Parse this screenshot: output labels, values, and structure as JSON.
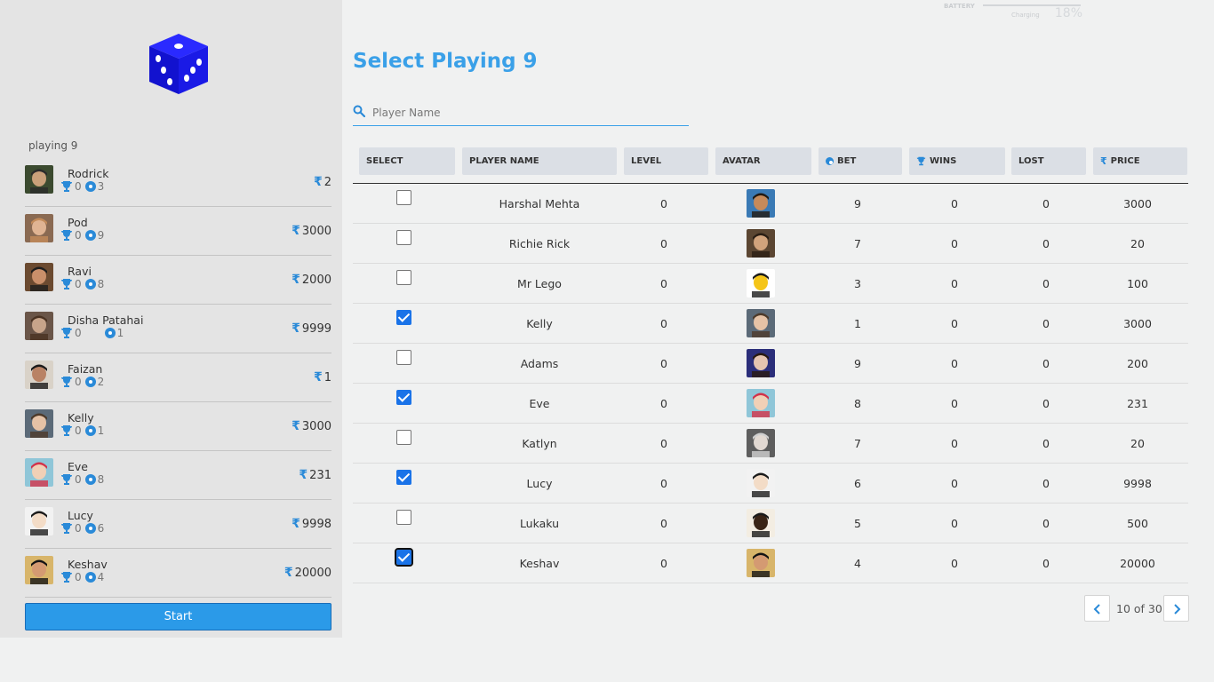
{
  "sidebar": {
    "caption": "playing 9",
    "start_label": "Start",
    "roster": [
      {
        "name": "Rodrick",
        "wins": "0",
        "bets": "3",
        "price": "2",
        "avatar": "av-rodrick"
      },
      {
        "name": "Pod",
        "wins": "0",
        "bets": "9",
        "price": "3000",
        "avatar": "av-pod"
      },
      {
        "name": "Ravi",
        "wins": "0",
        "bets": "8",
        "price": "2000",
        "avatar": "av-ravi"
      },
      {
        "name": "Disha Patahai",
        "wins": "0",
        "bets": "1",
        "price": "9999",
        "avatar": "av-disha"
      },
      {
        "name": "Faizan",
        "wins": "0",
        "bets": "2",
        "price": "1",
        "avatar": "av-faizan"
      },
      {
        "name": "Kelly",
        "wins": "0",
        "bets": "1",
        "price": "3000",
        "avatar": "av-kelly"
      },
      {
        "name": "Eve",
        "wins": "0",
        "bets": "8",
        "price": "231",
        "avatar": "av-eve"
      },
      {
        "name": "Lucy",
        "wins": "0",
        "bets": "6",
        "price": "9998",
        "avatar": "av-lucy"
      },
      {
        "name": "Keshav",
        "wins": "0",
        "bets": "4",
        "price": "20000",
        "avatar": "av-keshav"
      }
    ]
  },
  "battery": {
    "label": "BATTERY",
    "percent": "18%",
    "status": "Charging",
    "level": 0.18
  },
  "main": {
    "title": "Select Playing 9",
    "search": {
      "placeholder": "Player Name",
      "value": ""
    },
    "columns": [
      "SELECT",
      "PLAYER NAME",
      "LEVEL",
      "AVATAR",
      "BET",
      "WINS",
      "LOST",
      "PRICE"
    ],
    "rows": [
      {
        "checked": false,
        "name": "Harshal Mehta",
        "level": "0",
        "bet": "9",
        "wins": "0",
        "lost": "0",
        "price": "3000",
        "avatar": "av-harshal"
      },
      {
        "checked": false,
        "name": "Richie Rick",
        "level": "0",
        "bet": "7",
        "wins": "0",
        "lost": "0",
        "price": "20",
        "avatar": "av-richie"
      },
      {
        "checked": false,
        "name": "Mr Lego",
        "level": "0",
        "bet": "3",
        "wins": "0",
        "lost": "0",
        "price": "100",
        "avatar": "av-lego"
      },
      {
        "checked": true,
        "name": "Kelly",
        "level": "0",
        "bet": "1",
        "wins": "0",
        "lost": "0",
        "price": "3000",
        "avatar": "av-kelly"
      },
      {
        "checked": false,
        "name": "Adams",
        "level": "0",
        "bet": "9",
        "wins": "0",
        "lost": "0",
        "price": "200",
        "avatar": "av-adams"
      },
      {
        "checked": true,
        "name": "Eve",
        "level": "0",
        "bet": "8",
        "wins": "0",
        "lost": "0",
        "price": "231",
        "avatar": "av-eve"
      },
      {
        "checked": false,
        "name": "Katlyn",
        "level": "0",
        "bet": "7",
        "wins": "0",
        "lost": "0",
        "price": "20",
        "avatar": "av-katlyn"
      },
      {
        "checked": true,
        "name": "Lucy",
        "level": "0",
        "bet": "6",
        "wins": "0",
        "lost": "0",
        "price": "9998",
        "avatar": "av-lucy"
      },
      {
        "checked": false,
        "name": "Lukaku",
        "level": "0",
        "bet": "5",
        "wins": "0",
        "lost": "0",
        "price": "500",
        "avatar": "av-lukaku"
      },
      {
        "checked": true,
        "name": "Keshav",
        "level": "0",
        "bet": "4",
        "wins": "0",
        "lost": "0",
        "price": "20000",
        "avatar": "av-keshav",
        "focused": true
      }
    ],
    "pagination": {
      "text": "10 of 30"
    }
  },
  "colors": {
    "accent": "#3aa0e8",
    "dice": "#1616e0",
    "checkbox": "#1a73e8"
  }
}
